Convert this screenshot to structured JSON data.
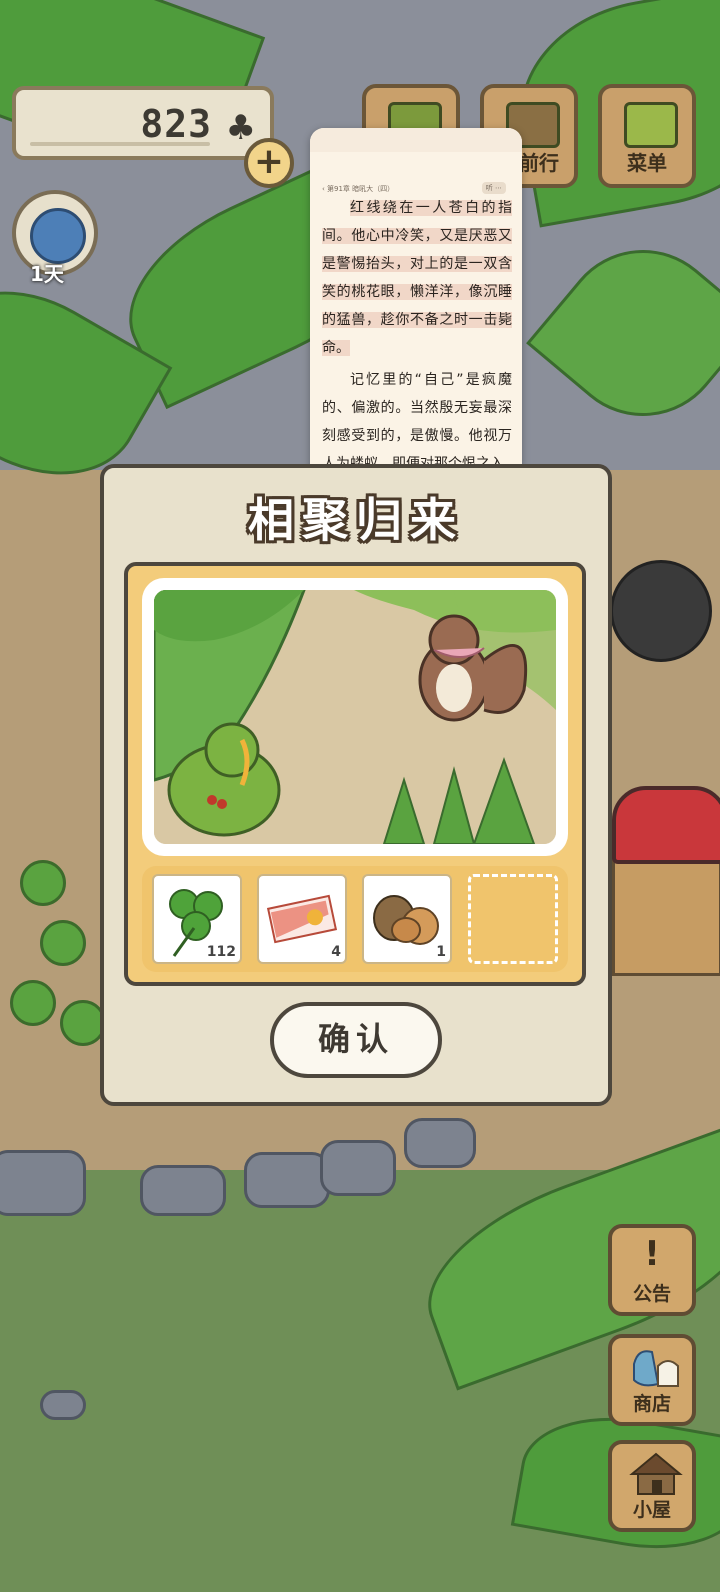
{
  "hud": {
    "clover_count": "823",
    "clover_symbol": "♣",
    "add_symbol": "+",
    "day_label": "1天"
  },
  "top_buttons": [
    {
      "label": ""
    },
    {
      "label": "准前行"
    },
    {
      "label": "菜单"
    }
  ],
  "reader": {
    "chapter": "‹ 第91章 暗吼大（四）",
    "tools": "听 ⋯",
    "paragraph1": "红线绕在一人苍白的指间。他心中冷笑，又是厌恶又是警惕抬头，对上的是一双含笑的桃花眼，懒洋洋，像沉睡的猛兽，趁你不备之时一击毙命。",
    "paragraph2": "记忆里的“自己”是疯魔的、偏激的。当然殷无妄最深刻感受到的，是傲慢。他视万人为蝼蚁，即便对那个恨之入"
  },
  "dialog": {
    "title": "相聚归来",
    "confirm_label": "确认",
    "items": [
      {
        "name": "clover",
        "count": "112"
      },
      {
        "name": "ticket",
        "count": "4"
      },
      {
        "name": "nuts",
        "count": "1"
      },
      {
        "name": "empty",
        "count": ""
      }
    ]
  },
  "side_buttons": [
    {
      "glyph": "!",
      "label": "公告"
    },
    {
      "glyph": "",
      "label": "商店"
    },
    {
      "glyph": "",
      "label": "小屋"
    }
  ],
  "colors": {
    "dialog_bg": "#e8e1cc",
    "panel_bg": "#f3cc7b",
    "button_wood": "#d1a76c",
    "grass": "#6f8f57"
  }
}
